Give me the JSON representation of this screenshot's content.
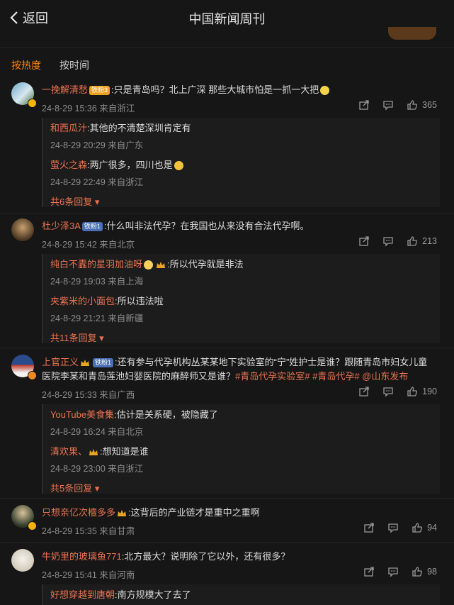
{
  "header": {
    "back_label": "返回",
    "title": "中国新闻周刊"
  },
  "sort": {
    "hot": "按热度",
    "time": "按时间"
  },
  "comments": [
    {
      "user": "一挽解清愁",
      "badge": "铁粉3",
      "text": ":只是青岛吗？北上广深 那些大城市怕是一抓一大把",
      "meta": "24-8-29 15:36 来自浙江",
      "likes": "365",
      "replies": [
        {
          "user": "和西瓜汁",
          "text": ":其他的不清楚深圳肯定有",
          "meta": "24-8-29 20:29 来自广东"
        },
        {
          "user": "萤火之森",
          "text": ":两广很多，四川也是",
          "meta": "24-8-29 22:49 来自浙江"
        }
      ],
      "more": "共6条回复"
    },
    {
      "user": "杜少泽3A",
      "badge": "铁粉1",
      "text": ":什么叫非法代孕？在我国也从来没有合法代孕啊。",
      "meta": "24-8-29 15:42 来自北京",
      "likes": "213",
      "replies": [
        {
          "user": "纯白不蠹的星羽加油呀",
          "text": ":所以代孕就是非法",
          "meta": "24-8-29 19:03 来自上海"
        },
        {
          "user": "夹紫米的小面包",
          "text": ":所以违法啦",
          "meta": "24-8-29 21:21 来自新疆"
        }
      ],
      "more": "共11条回复"
    },
    {
      "user": "上官正义",
      "badge": "铁粉1",
      "text": ":还有参与代孕机构丛某某地下实验室的“宁”姓护士是谁？跟随青岛市妇女儿童",
      "text2": "医院李某和青岛莲池妇婴医院的麻醉师又是谁？",
      "tags": "#青岛代孕实验室# #青岛代孕# @山东发布",
      "meta": "24-8-29 15:33 来自广西",
      "likes": "190",
      "replies": [
        {
          "user": "YouTube美食集",
          "text": ":估计是关系硬，被隐藏了",
          "meta": "24-8-29 16:24 来自北京"
        },
        {
          "user": "清欢果、",
          "text": ":想知道是谁",
          "meta": "24-8-29 23:00 来自浙江"
        }
      ],
      "more": "共5条回复"
    },
    {
      "user": "只想亲亿次檀多多",
      "text": ":这背后的产业链才是重中之重啊",
      "meta": "24-8-29 15:35 来自甘肃",
      "likes": "94"
    },
    {
      "user": "牛奶里的玻璃鱼771",
      "text": ":北方最大？说明除了它以外，还有很多？",
      "meta": "24-8-29 15:41 来自河南",
      "likes": "98",
      "replies": [
        {
          "user": "好想穿越到唐朝",
          "text": ":南方规模大了去了"
        }
      ]
    }
  ],
  "colors": {
    "accent": "#ff8200",
    "username": "#eb7350",
    "background": "#161616"
  }
}
